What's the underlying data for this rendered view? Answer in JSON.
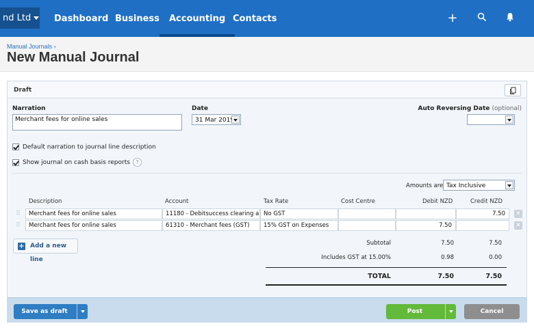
{
  "nav": {
    "org_label": "nd Ltd",
    "links": [
      "Dashboard",
      "Business",
      "Accounting",
      "Contacts"
    ],
    "active": "Accounting"
  },
  "header": {
    "breadcrumb": "Manual Journals ›",
    "title": "New Manual Journal"
  },
  "form": {
    "status": "Draft",
    "narration_label": "Narration",
    "narration_value": "Merchant fees for online sales",
    "date_label": "Date",
    "date_value": "31 Mar 2019",
    "auto_reversing_label": "Auto Reversing Date",
    "auto_reversing_optional": "(optional)",
    "auto_reversing_value": "",
    "check_default_narration": "Default narration to journal line description",
    "check_cash_basis": "Show journal on cash basis reports",
    "help_glyph": "?",
    "amounts_are_label": "Amounts are",
    "amounts_are_value": "Tax Inclusive"
  },
  "table": {
    "headers": [
      "Description",
      "Account",
      "Tax Rate",
      "Cost Centre",
      "Debit NZD",
      "Credit NZD"
    ],
    "rows": [
      {
        "description": "Merchant fees for online sales",
        "account": "11180 - Debitsuccess clearing a...",
        "tax_rate": "No GST",
        "cost_centre": "",
        "debit": "",
        "credit": "7.50"
      },
      {
        "description": "Merchant fees for online sales",
        "account": "61310 - Merchant fees (GST)",
        "tax_rate": "15% GST on Expenses",
        "cost_centre": "",
        "debit": "7.50",
        "credit": ""
      }
    ],
    "add_line_label": "Add a new line"
  },
  "totals": {
    "subtotal_label": "Subtotal",
    "subtotal_debit": "7.50",
    "subtotal_credit": "7.50",
    "gst_label": "Includes GST at 15.00%",
    "gst_debit": "0.98",
    "gst_credit": "0.00",
    "total_label": "TOTAL",
    "total_debit": "7.50",
    "total_credit": "7.50"
  },
  "footer": {
    "save_draft_label": "Save as draft",
    "post_label": "Post",
    "cancel_label": "Cancel"
  },
  "colors": {
    "nav_bg": "#1f6fc5",
    "post_green": "#63b93a",
    "draft_blue": "#2f7dc2"
  }
}
